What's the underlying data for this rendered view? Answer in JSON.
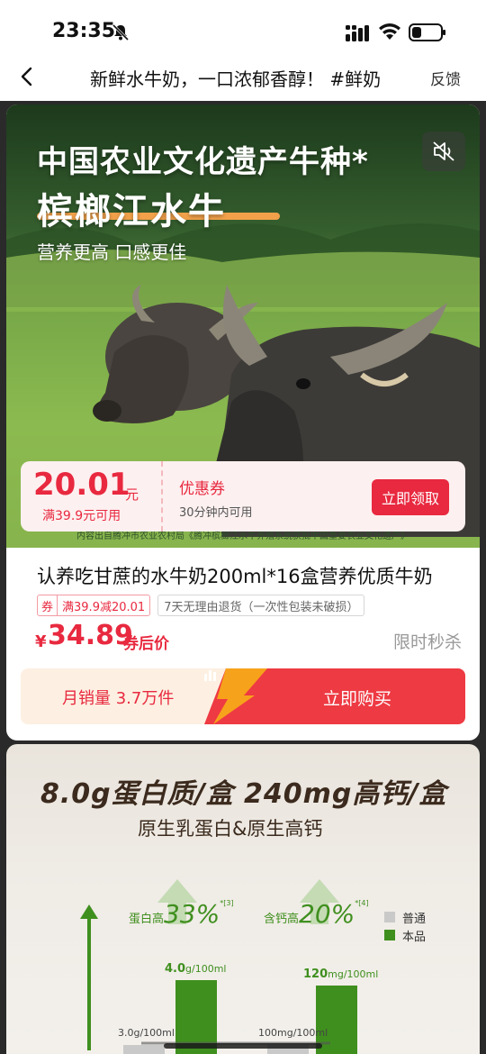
{
  "status_bar": {
    "time": "23:35"
  },
  "nav": {
    "title": "新鲜水牛奶，一口浓郁香醇！ #鲜奶",
    "feedback": "反馈"
  },
  "hero": {
    "title": "中国农业文化遗产牛种*",
    "subtitle": "槟榔江水牛",
    "tagline": "营养更高  口感更佳",
    "footnote": "内容出自腾冲市农业农村局《腾冲槟榔江水牛养殖系统获批中国重要农业文化遗产》"
  },
  "coupon": {
    "amount": "20.01",
    "unit": "元",
    "condition": "满39.9元可用",
    "type": "优惠券",
    "validity": "30分钟内可用",
    "claim_label": "立即领取"
  },
  "product": {
    "title": "认养吃甘蔗的水牛奶200ml*16盒营养优质牛奶",
    "tag_coupon_prefix": "券",
    "tag_coupon_text": "满39.9减20.01",
    "tag_return": "7天无理由退货（一次性包装未破损）",
    "price_symbol": "¥",
    "price": "34.89",
    "price_label": "券后价",
    "flash_sale": "限时秒杀"
  },
  "buy_bar": {
    "monthly_sales": "月销量 3.7万件",
    "buy_label": "立即购买"
  },
  "detail": {
    "headline": "8.0g蛋白质/盒  240mg高钙/盒",
    "subheadline": "原生乳蛋白&原生高钙",
    "protein_label": "蛋白高",
    "protein_pct": "33%",
    "protein_ref": "*[3]",
    "calcium_label": "含钙高",
    "calcium_pct": "20%",
    "calcium_ref": "*[4]",
    "legend_normal": "普通",
    "legend_product": "本品",
    "protein_product_value": "4.0",
    "protein_product_unit": "g/100ml",
    "protein_normal": "3.0g/100ml",
    "calcium_product_value": "120",
    "calcium_product_unit": "mg/100ml",
    "calcium_normal": "100mg/100ml"
  },
  "colors": {
    "accent": "#e8293f",
    "green": "#3f8f1e"
  }
}
